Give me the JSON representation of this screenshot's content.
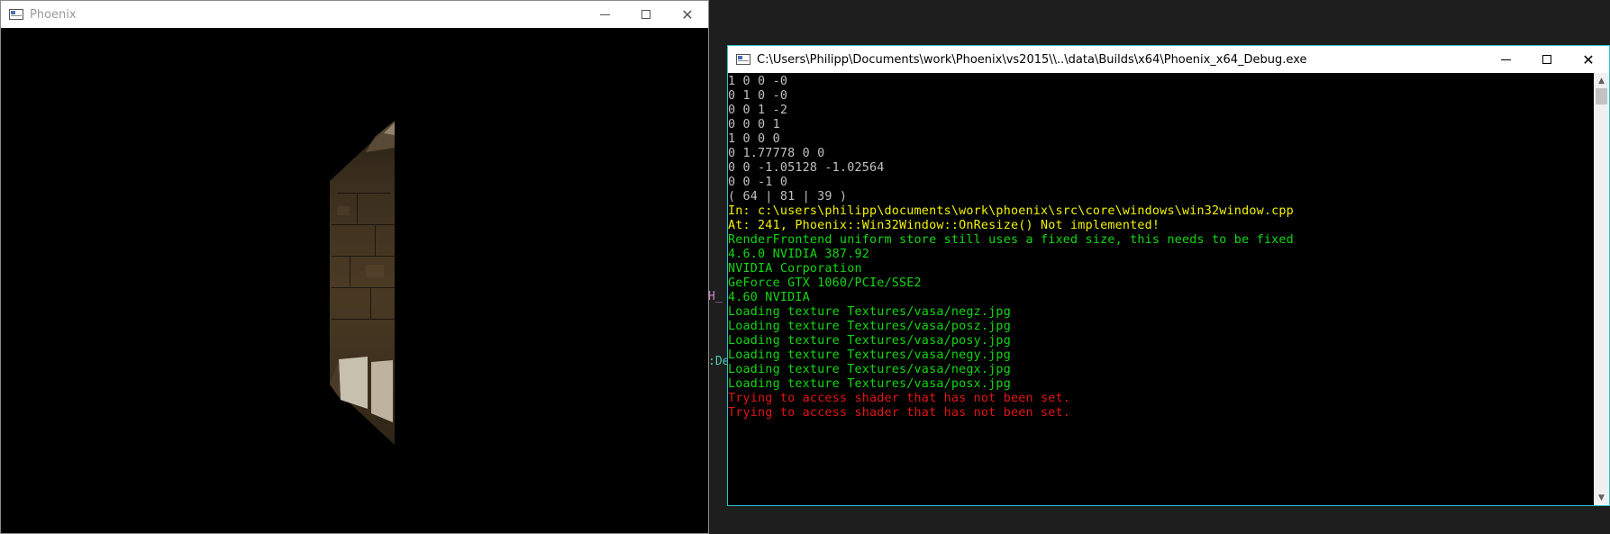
{
  "background": {
    "fragment_purple": "H_",
    "fragment_teal": ":Des"
  },
  "phoenix_window": {
    "title": "Phoenix",
    "minimize": "—",
    "close": "✕"
  },
  "console_window": {
    "title": "C:\\Users\\Philipp\\Documents\\work\\Phoenix\\vs2015\\\\..\\data\\Builds\\x64\\Phoenix_x64_Debug.exe",
    "lines": [
      {
        "text": "1 0 0 -0",
        "color": "gray"
      },
      {
        "text": "0 1 0 -0",
        "color": "gray"
      },
      {
        "text": "0 0 1 -2",
        "color": "gray"
      },
      {
        "text": "0 0 0 1",
        "color": "gray"
      },
      {
        "text": "1 0 0 0",
        "color": "gray"
      },
      {
        "text": "0 1.77778 0 0",
        "color": "gray"
      },
      {
        "text": "0 0 -1.05128 -1.02564",
        "color": "gray"
      },
      {
        "text": "0 0 -1 0",
        "color": "gray"
      },
      {
        "text": "( 64 | 81 | 39 )",
        "color": "gray"
      },
      {
        "text": "In: c:\\users\\philipp\\documents\\work\\phoenix\\src\\core\\windows\\win32window.cpp",
        "color": "yellow"
      },
      {
        "text": "At: 241, Phoenix::Win32Window::OnResize() Not implemented!",
        "color": "yellow"
      },
      {
        "text": "RenderFrontend uniform store still uses a fixed size, this needs to be fixed",
        "color": "green"
      },
      {
        "text": "4.6.0 NVIDIA 387.92",
        "color": "green"
      },
      {
        "text": "NVIDIA Corporation",
        "color": "green"
      },
      {
        "text": "GeForce GTX 1060/PCIe/SSE2",
        "color": "green"
      },
      {
        "text": "4.60 NVIDIA",
        "color": "green"
      },
      {
        "text": "Loading texture Textures/vasa/negz.jpg",
        "color": "green"
      },
      {
        "text": "Loading texture Textures/vasa/posz.jpg",
        "color": "green"
      },
      {
        "text": "Loading texture Textures/vasa/posy.jpg",
        "color": "green"
      },
      {
        "text": "Loading texture Textures/vasa/negy.jpg",
        "color": "green"
      },
      {
        "text": "Loading texture Textures/vasa/negx.jpg",
        "color": "green"
      },
      {
        "text": "Loading texture Textures/vasa/posx.jpg",
        "color": "green"
      },
      {
        "text": "Trying to access shader that has not been set.",
        "color": "red"
      },
      {
        "text": "Trying to access shader that has not been set.",
        "color": "red"
      }
    ]
  },
  "colors": {
    "gray": "#c0c0c0",
    "yellow": "#f2f200",
    "green": "#13d713",
    "red": "#e31414",
    "console_border": "#2bc3c9"
  }
}
